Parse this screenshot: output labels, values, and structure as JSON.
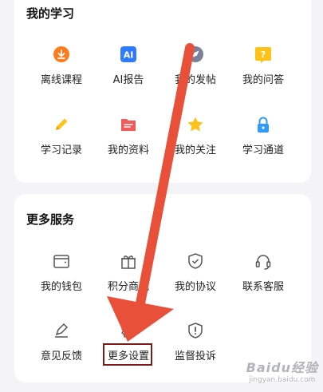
{
  "sections": {
    "study": {
      "title": "我的学习",
      "items": [
        {
          "label": "离线课程",
          "icon": "download-icon",
          "color": "#ff7a1a"
        },
        {
          "label": "AI报告",
          "icon": "ai-report-icon",
          "color": "#2f7bff"
        },
        {
          "label": "我的发帖",
          "icon": "compass-icon",
          "color": "#7a7f9a"
        },
        {
          "label": "我的问答",
          "icon": "question-icon",
          "color": "#ffc21a"
        },
        {
          "label": "学习记录",
          "icon": "pencil-icon",
          "color": "#ffc21a"
        },
        {
          "label": "我的资料",
          "icon": "folder-icon",
          "color": "#f25a5a"
        },
        {
          "label": "我的关注",
          "icon": "star-icon",
          "color": "#ffc21a"
        },
        {
          "label": "学习通道",
          "icon": "lock-icon",
          "color": "#2f9bff"
        }
      ]
    },
    "services": {
      "title": "更多服务",
      "items": [
        {
          "label": "我的钱包",
          "icon": "wallet-icon"
        },
        {
          "label": "积分商城",
          "icon": "gift-icon"
        },
        {
          "label": "我的协议",
          "icon": "shield-check-icon"
        },
        {
          "label": "联系客服",
          "icon": "headset-icon"
        },
        {
          "label": "意见反馈",
          "icon": "feedback-icon"
        },
        {
          "label": "更多设置",
          "icon": "gear-icon"
        },
        {
          "label": "监督投诉",
          "icon": "alert-shield-icon"
        }
      ]
    }
  },
  "annotation": {
    "arrow_color": "#e8503a",
    "highlight_color": "#7a1a1a"
  },
  "watermark": {
    "main": "Baidu经验",
    "sub": "jingyan.baidu.com"
  }
}
